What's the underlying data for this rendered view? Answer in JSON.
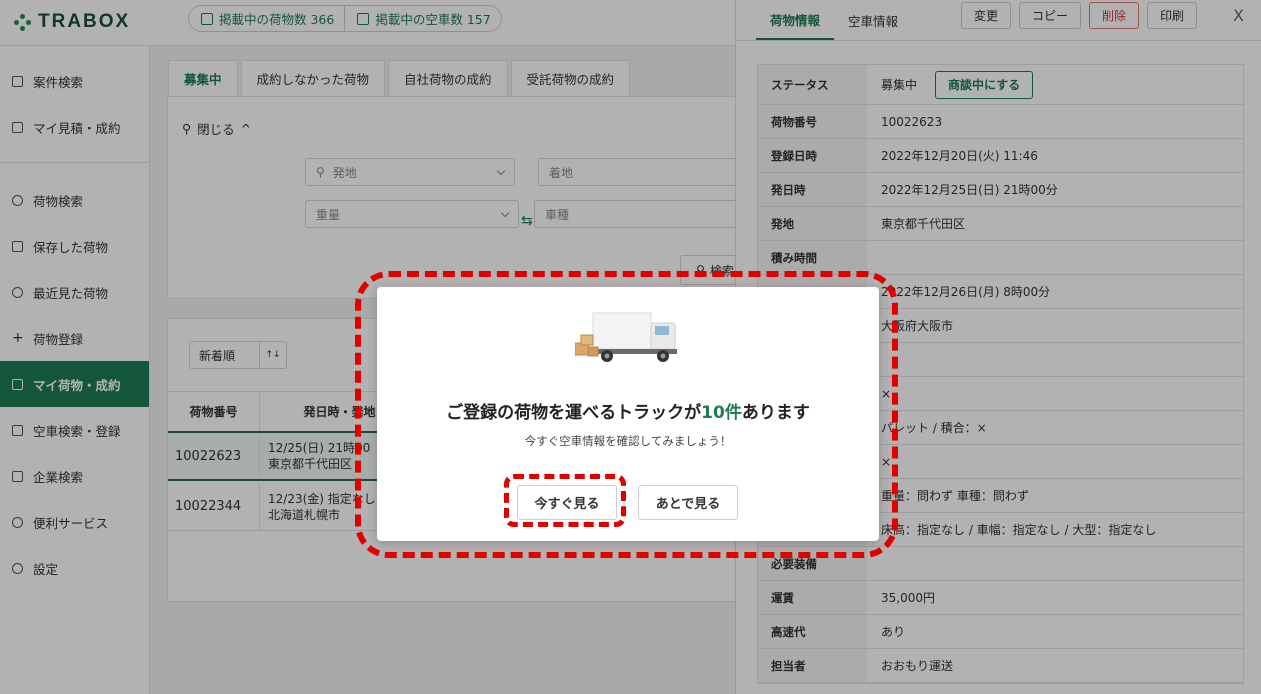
{
  "header": {
    "logo_text": "TRABOX",
    "cargo_count_label": "掲載中の荷物数 366",
    "truck_count_label": "掲載中の空車数 157"
  },
  "sidebar": {
    "items": [
      {
        "label": "案件検索",
        "icon": "document-search-icon"
      },
      {
        "label": "マイ見積・成約",
        "icon": "calculator-icon"
      },
      {
        "label": "荷物検索",
        "icon": "search-icon"
      },
      {
        "label": "保存した荷物",
        "icon": "bookmark-icon"
      },
      {
        "label": "最近見た荷物",
        "icon": "clock-icon"
      },
      {
        "label": "荷物登録",
        "icon": "plus-icon"
      },
      {
        "label": "マイ荷物・成約",
        "icon": "box-icon"
      },
      {
        "label": "空車検索・登録",
        "icon": "truck-list-icon"
      },
      {
        "label": "企業検索",
        "icon": "building-icon"
      },
      {
        "label": "便利サービス",
        "icon": "network-icon"
      },
      {
        "label": "設定",
        "icon": "gear-icon"
      }
    ]
  },
  "main": {
    "tabs": [
      "募集中",
      "成約しなかった荷物",
      "自社荷物の成約",
      "受託荷物の成約"
    ],
    "close_toggle": "閉じる",
    "fields": {
      "origin": "発地",
      "destination": "着地",
      "weight": "重量",
      "vehicle_type": "車種"
    },
    "search_button": "検索",
    "sort_label": "新着順",
    "table": {
      "headers": [
        "荷物番号",
        "発日時・発地"
      ],
      "rows": [
        {
          "id": "10022623",
          "date": "12/25(日) 21時00",
          "place": "東京都千代田区"
        },
        {
          "id": "10022344",
          "date": "12/23(金) 指定なし",
          "place": "北海道札幌市"
        }
      ]
    }
  },
  "panel": {
    "tabs": [
      "荷物情報",
      "空車情報"
    ],
    "buttons": [
      "変更",
      "コピー",
      "削除",
      "印刷"
    ],
    "close": "X",
    "status_button": "商談中にする",
    "details": [
      {
        "key": "ステータス",
        "value": "募集中"
      },
      {
        "key": "荷物番号",
        "value": "10022623"
      },
      {
        "key": "登録日時",
        "value": "2022年12月20日(火) 11:46"
      },
      {
        "key": "発日時",
        "value": "2022年12月25日(日) 21時00分"
      },
      {
        "key": "発地",
        "value": "東京都千代田区"
      },
      {
        "key": "積み時間",
        "value": ""
      },
      {
        "key": "",
        "value": "2022年12月26日(月) 8時00分"
      },
      {
        "key": "",
        "value": "大阪府大阪市"
      },
      {
        "key": "",
        "value": ""
      },
      {
        "key": "",
        "value": "×"
      },
      {
        "key": "",
        "value": "パレット / 積合：×"
      },
      {
        "key": "",
        "value": "×"
      },
      {
        "key": "",
        "value": "重量：問わず 車種：問わず"
      },
      {
        "key": "",
        "value": "床高：指定なし / 車幅：指定なし / 大型：指定なし"
      },
      {
        "key": "必要装備",
        "value": ""
      },
      {
        "key": "運賃",
        "value": "35,000円"
      },
      {
        "key": "高速代",
        "value": "あり"
      },
      {
        "key": "担当者",
        "value": "おおもり運送"
      }
    ]
  },
  "modal": {
    "title_pre": "ご登録の荷物を運べるトラックが",
    "title_highlight": "10件",
    "title_post": "あります",
    "subtitle": "今すぐ空車情報を確認してみましょう！",
    "primary_button": "今すぐ見る",
    "secondary_button": "あとで見る"
  },
  "colors": {
    "brand_green": "#1e7b52",
    "highlight_red": "#e00000"
  }
}
